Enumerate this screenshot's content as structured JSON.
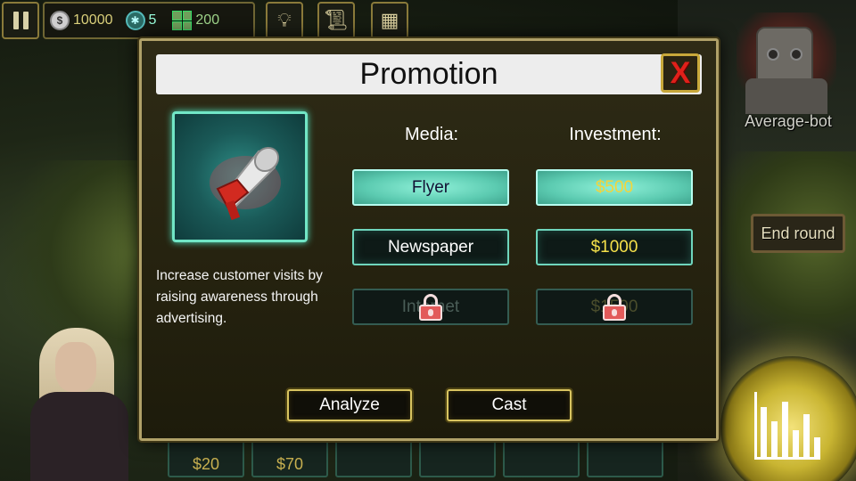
{
  "hud": {
    "coins": "10000",
    "gems": "5",
    "boxes": "200",
    "coin_symbol": "$",
    "icons": [
      "pause-icon",
      "lightbulb-icon",
      "scroll-icon",
      "calendar-icon"
    ]
  },
  "side": {
    "bot_name": "Average-bot",
    "end_round_label": "End round"
  },
  "tray": {
    "slots": [
      "$20",
      "$70",
      "",
      "",
      "",
      ""
    ]
  },
  "modal": {
    "title": "Promotion",
    "close_label": "X",
    "description": "Increase customer visits by raising awareness through advertising.",
    "media_header": "Media:",
    "investment_header": "Investment:",
    "media_options": [
      {
        "label": "Flyer",
        "state": "selected"
      },
      {
        "label": "Newspaper",
        "state": "normal"
      },
      {
        "label": "Internet",
        "state": "locked"
      }
    ],
    "investment_options": [
      {
        "label": "$500",
        "state": "selected"
      },
      {
        "label": "$1000",
        "state": "normal"
      },
      {
        "label": "$1500",
        "state": "locked"
      }
    ],
    "analyze_label": "Analyze",
    "cast_label": "Cast"
  },
  "colors": {
    "accent_teal": "#5ccbb1",
    "gold": "#d8c460",
    "close_red": "#e0201a"
  }
}
